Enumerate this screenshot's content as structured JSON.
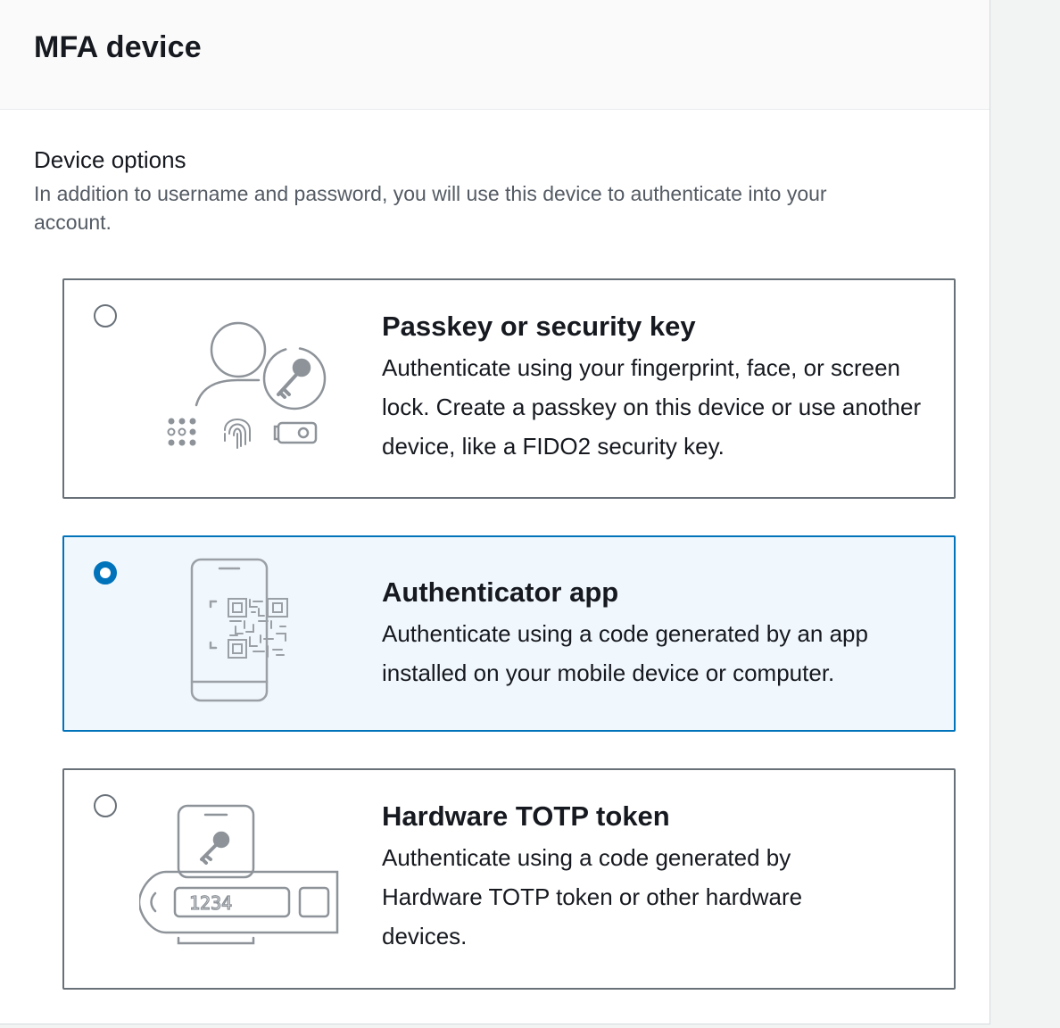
{
  "panel": {
    "title": "MFA device"
  },
  "device_options": {
    "label": "Device options",
    "description": "In addition to username and password, you will use this device to authenticate into your account."
  },
  "options": [
    {
      "title": "Passkey or security key",
      "description": "Authenticate using your fingerprint, face, or screen lock. Create a passkey on this device or use another device, like a FIDO2 security key.",
      "selected": false,
      "icon": "passkey-icon"
    },
    {
      "title": "Authenticator app",
      "description": "Authenticate using a code generated by an app installed on your mobile device or computer.",
      "selected": true,
      "icon": "authenticator-app-icon"
    },
    {
      "title": "Hardware TOTP token",
      "description": "Authenticate using a code generated by Hardware TOTP token or other hardware devices.",
      "selected": false,
      "icon": "hardware-token-icon",
      "token_display": "1234"
    }
  ],
  "colors": {
    "accent": "#0073bb",
    "selected_bg": "#f1f8fd",
    "border": "#687078",
    "icon_stroke": "#8d9399"
  }
}
